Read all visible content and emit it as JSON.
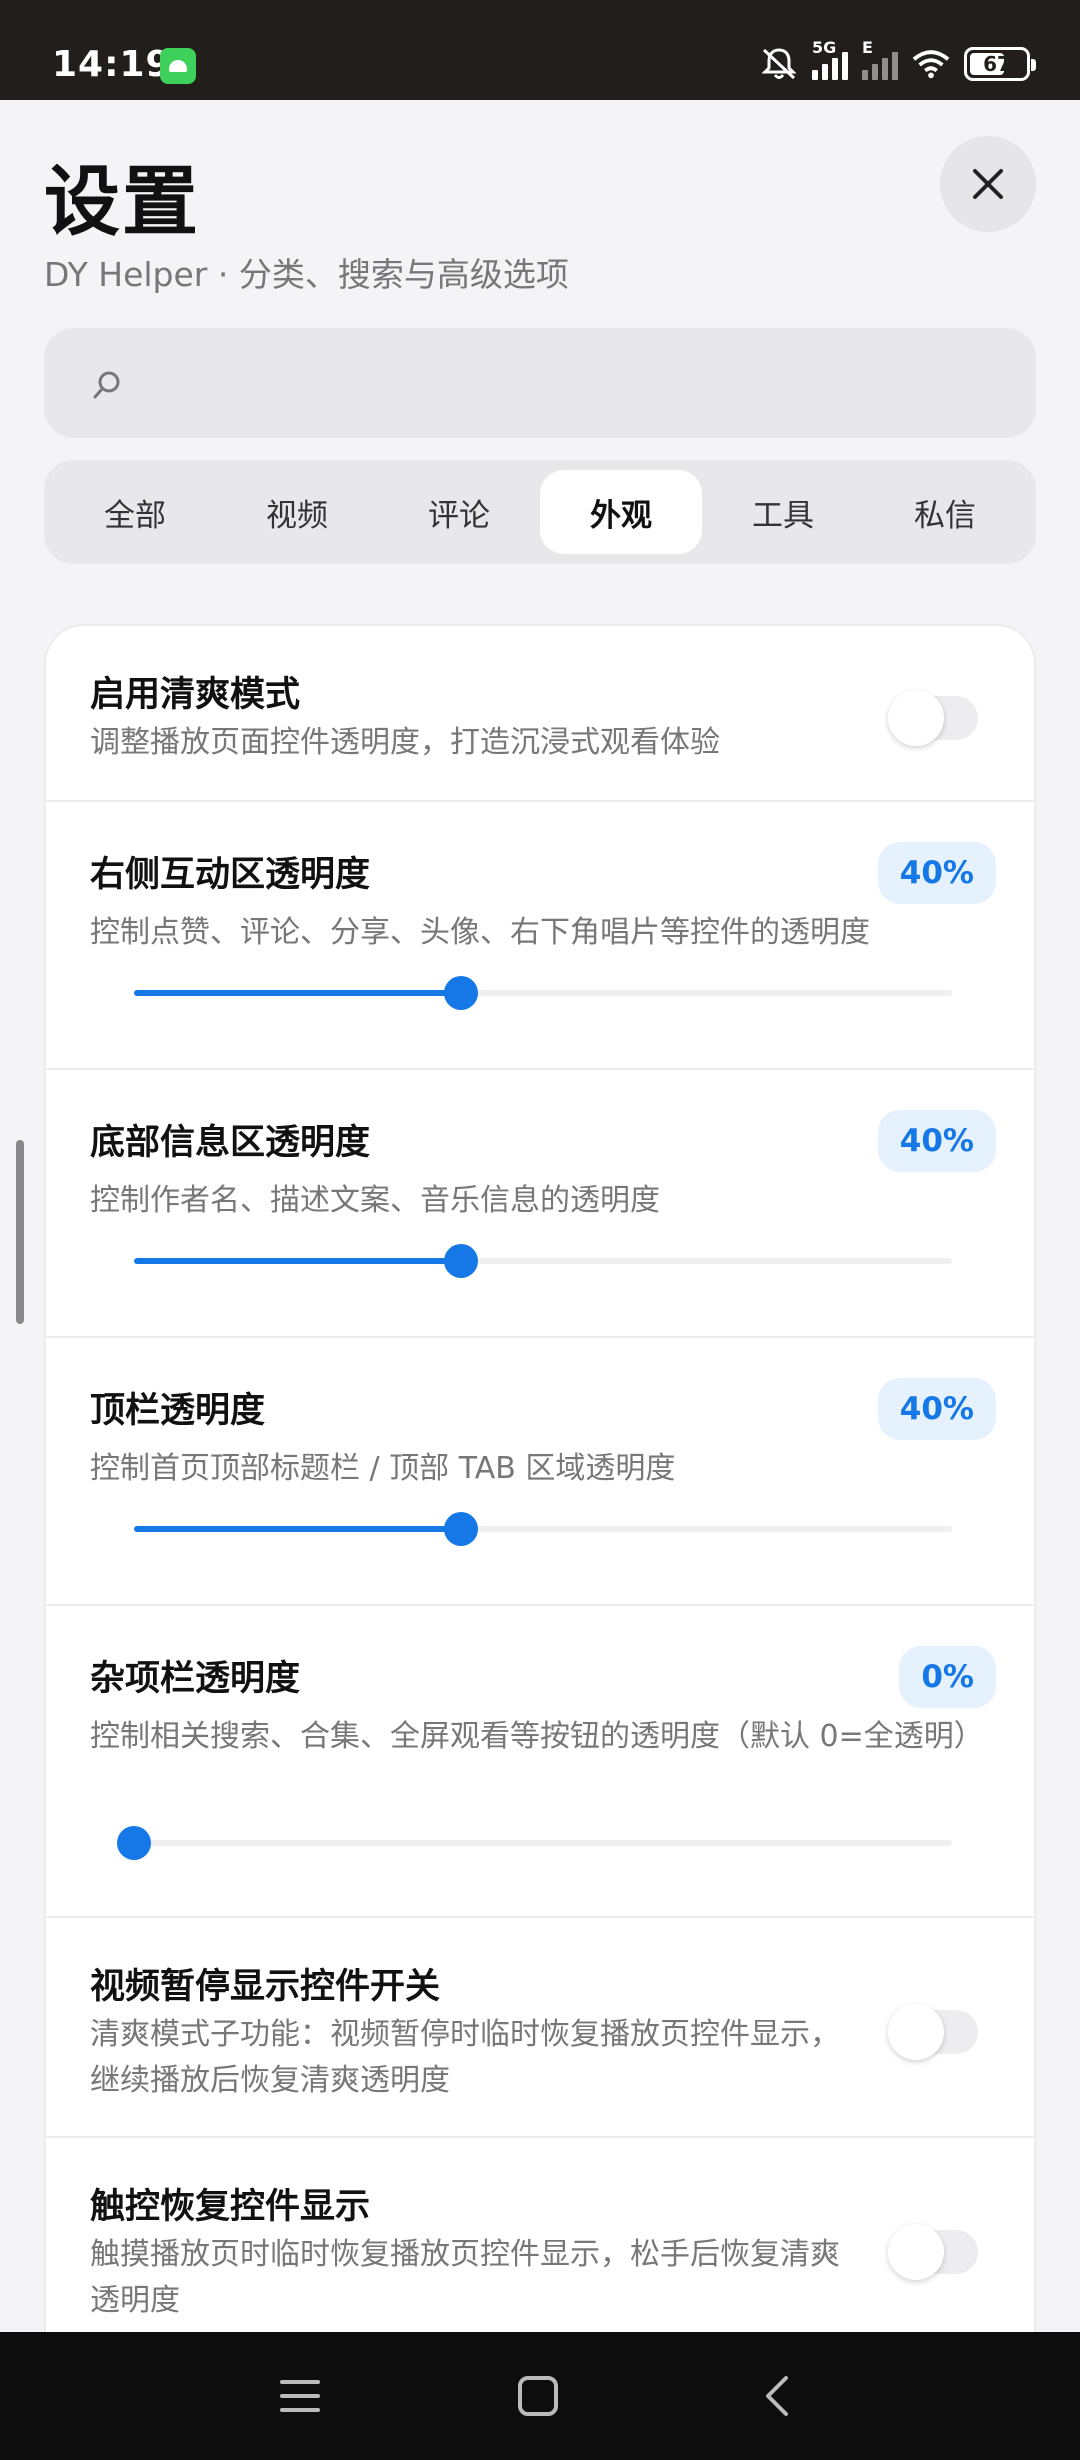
{
  "status_bar": {
    "time": "14:19",
    "network_tag": "5G",
    "network_tag2": "E",
    "battery": "67",
    "battery_level": 0.67
  },
  "header": {
    "title": "设置",
    "subtitle": "DY Helper · 分类、搜索与高级选项"
  },
  "search": {
    "placeholder": ""
  },
  "tabs": [
    {
      "label": "全部",
      "active": false
    },
    {
      "label": "视频",
      "active": false
    },
    {
      "label": "评论",
      "active": false
    },
    {
      "label": "外观",
      "active": true
    },
    {
      "label": "工具",
      "active": false
    },
    {
      "label": "私信",
      "active": false
    }
  ],
  "settings": {
    "clean_mode": {
      "title": "启用清爽模式",
      "desc": "调整播放页面控件透明度，打造沉浸式观看体验",
      "enabled": false
    },
    "right_opacity": {
      "title": "右侧互动区透明度",
      "desc": "控制点赞、评论、分享、头像、右下角唱片等控件的透明度",
      "value_label": "40%",
      "value": 0.4
    },
    "bottom_opacity": {
      "title": "底部信息区透明度",
      "desc": "控制作者名、描述文案、音乐信息的透明度",
      "value_label": "40%",
      "value": 0.4
    },
    "top_opacity": {
      "title": "顶栏透明度",
      "desc": "控制首页顶部标题栏 / 顶部 TAB 区域透明度",
      "value_label": "40%",
      "value": 0.4
    },
    "misc_opacity": {
      "title": "杂项栏透明度",
      "desc": "控制相关搜索、合集、全屏观看等按钮的透明度（默认 0=全透明）",
      "value_label": "0%",
      "value": 0
    },
    "pause_show": {
      "title": "视频暂停显示控件开关",
      "desc": "清爽模式子功能：视频暂停时临时恢复播放页控件显示，继续播放后恢复清爽透明度",
      "enabled": false
    },
    "touch_restore": {
      "title": "触控恢复控件显示",
      "desc": "触摸播放页时临时恢复播放页控件显示，松手后恢复清爽透明度",
      "enabled": false
    }
  },
  "colors": {
    "accent": "#1677e6",
    "badge_bg": "#e5f1fd",
    "status_bar_bg": "#221e1b",
    "nav_bar_bg": "#0d0d0d"
  },
  "icons": {
    "close": "close-icon",
    "search": "search-icon",
    "menu": "menu-icon",
    "home": "home-icon",
    "back": "back-icon"
  }
}
